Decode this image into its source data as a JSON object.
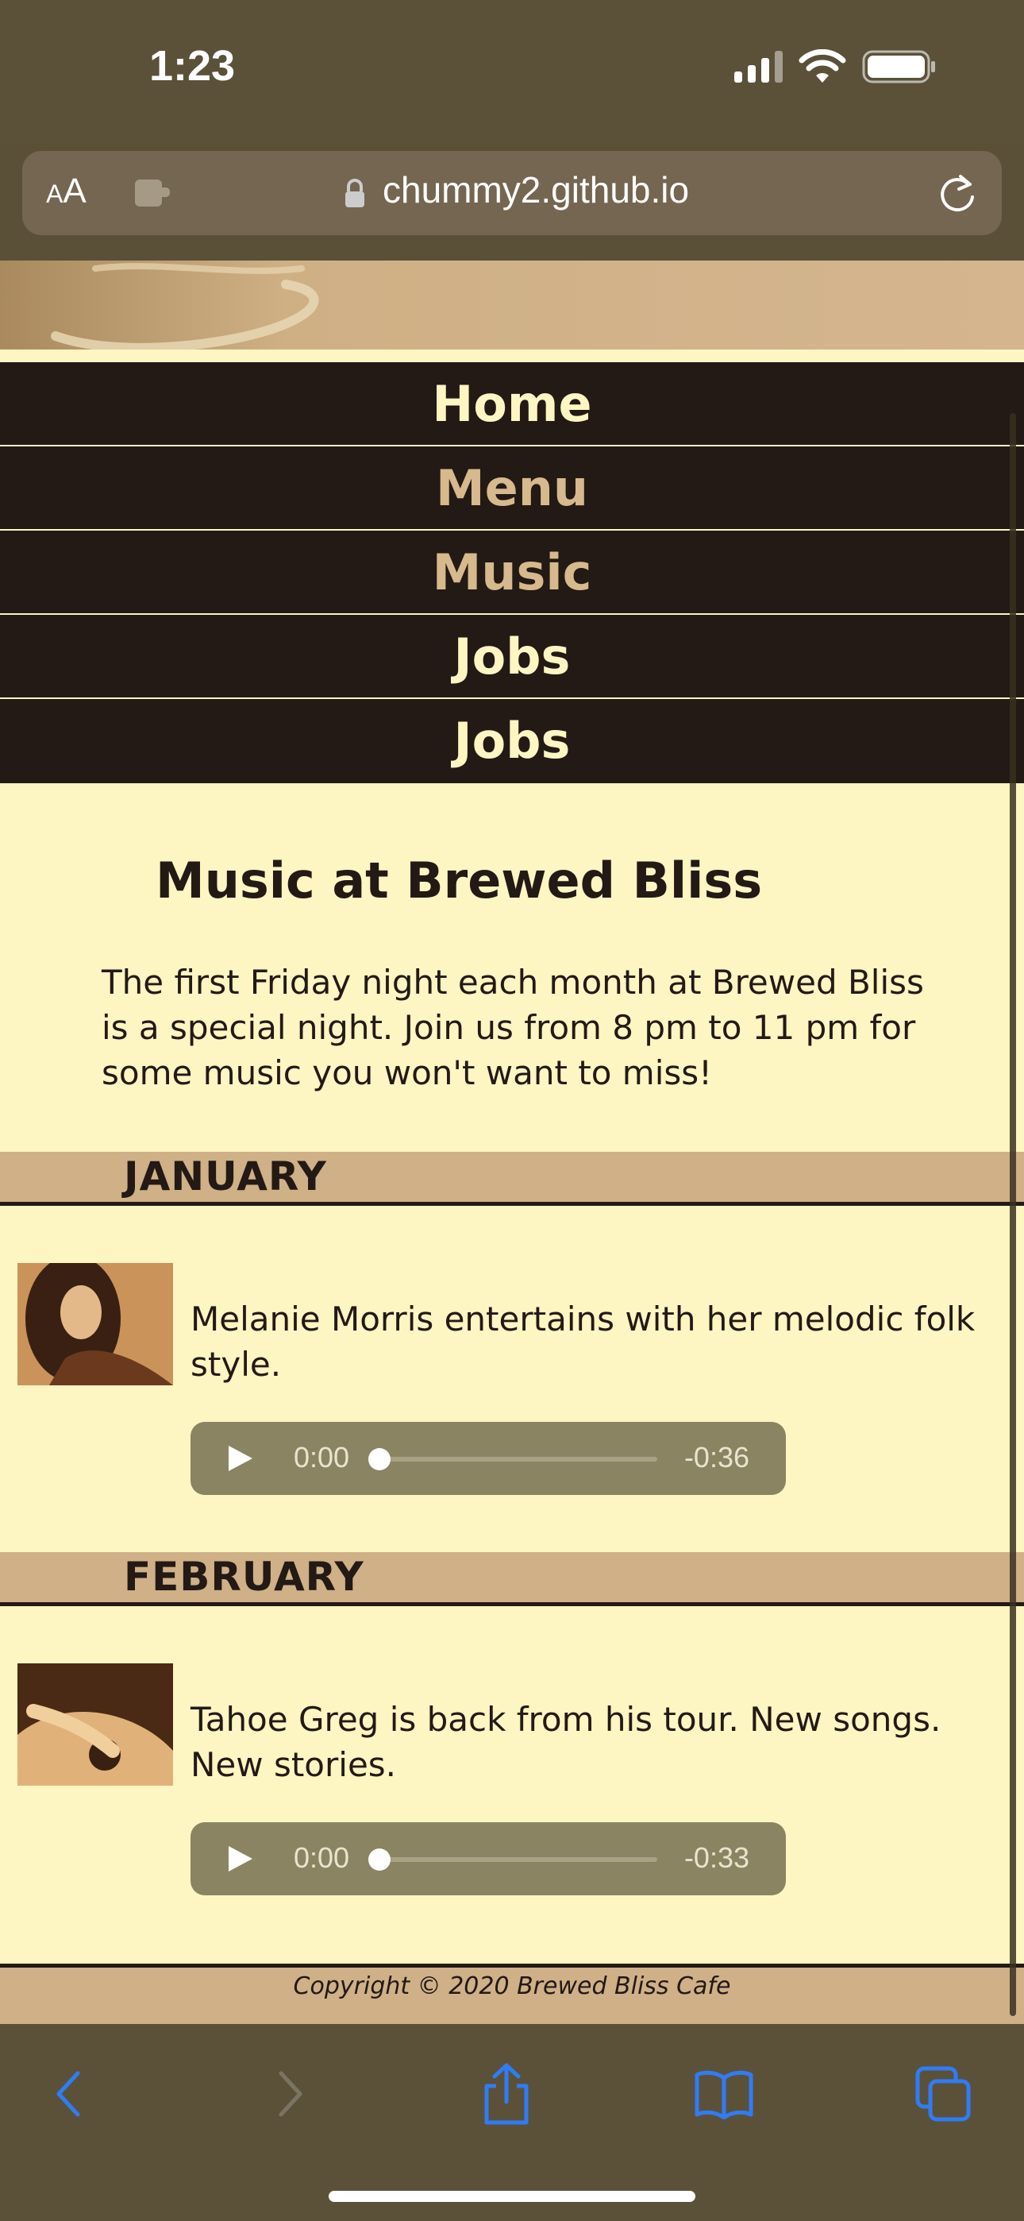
{
  "status_bar": {
    "time": "1:23"
  },
  "browser": {
    "text_size_label": "AA",
    "url": "chummy2.github.io"
  },
  "nav": {
    "items": [
      "Home",
      "Menu",
      "Music",
      "Jobs",
      "Jobs"
    ]
  },
  "page": {
    "title": "Music at Brewed Bliss",
    "intro": "The first Friday night each month at Brewed Bliss is a special night. Join us from 8 pm to 11 pm for some music you won't want to miss!",
    "months": [
      {
        "label": "JANUARY",
        "description": "Melanie Morris entertains with her melodic folk style.",
        "audio": {
          "current": "0:00",
          "remaining": "-0:36"
        }
      },
      {
        "label": "FEBRUARY",
        "description": "Tahoe Greg is back from his tour. New songs. New stories.",
        "audio": {
          "current": "0:00",
          "remaining": "-0:33"
        }
      }
    ],
    "footer": "Copyright © 2020 Brewed Bliss Cafe"
  },
  "colors": {
    "nav_bg": "#231915",
    "page_bg": "#fdf5c2",
    "band_bg": "#cfb087",
    "nav_text": "#fdf5c2",
    "nav_alt_text": "#d6b98c",
    "ios_blue": "#2f7cf6"
  }
}
